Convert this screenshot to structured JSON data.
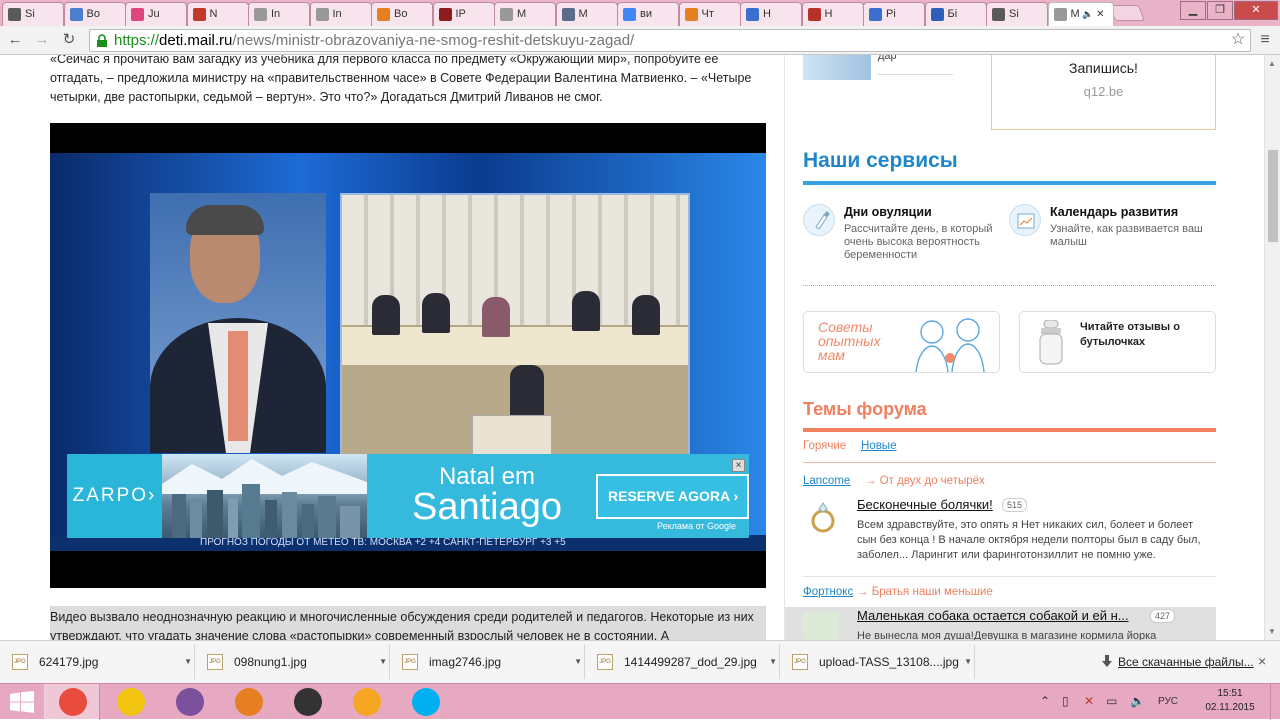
{
  "browser": {
    "tabs": [
      {
        "label": "Si",
        "icon_color": "#5a5a5a",
        "icon": "triangle-icon"
      },
      {
        "label": "Bo",
        "icon_color": "#4a7fcf",
        "icon": "grid-icon"
      },
      {
        "label": "Ju",
        "icon_color": "#e0457b",
        "icon": "letter-i-icon"
      },
      {
        "label": "N",
        "icon_color": "#c0392b",
        "icon": "nm-icon"
      },
      {
        "label": "In",
        "icon_color": "#999999",
        "icon": "page-icon"
      },
      {
        "label": "In",
        "icon_color": "#999999",
        "icon": "page-icon"
      },
      {
        "label": "Bo",
        "icon_color": "#e67e22",
        "icon": "pencil-icon"
      },
      {
        "label": "IP",
        "icon_color": "#8e1e1e",
        "icon": "circle-icon"
      },
      {
        "label": "M",
        "icon_color": "#999999",
        "icon": "page-icon"
      },
      {
        "label": "M",
        "icon_color": "#5b6b8a",
        "icon": "m-icon"
      },
      {
        "label": "ви",
        "icon_color": "#4285f4",
        "icon": "google-icon"
      },
      {
        "label": "Чт",
        "icon_color": "#e67e22",
        "icon": "pencil-icon"
      },
      {
        "label": "Н",
        "icon_color": "#3a6fd0",
        "icon": "puzzle-icon"
      },
      {
        "label": "Н",
        "icon_color": "#b8322a",
        "icon": "emblem-icon"
      },
      {
        "label": "Рі",
        "icon_color": "#3a6fd0",
        "icon": "news-icon"
      },
      {
        "label": "Бі",
        "icon_color": "#2b5fb8",
        "icon": "letter-b-icon"
      },
      {
        "label": "Si",
        "icon_color": "#5a5a5a",
        "icon": "triangle-icon"
      },
      {
        "label": "M",
        "icon_color": "#999999",
        "icon": "page-icon",
        "active": true
      }
    ],
    "url_scheme": "https://",
    "url_host": "deti.mail.ru",
    "url_path": "/news/ministr-obrazovaniya-ne-smog-reshit-detskuyu-zagad/"
  },
  "article": {
    "para1": "«Сейчас я прочитаю вам загадку из учебника для первого класса по предмету «Окружающий мир», попробуйте ее отгадать, – предложила министру на «правительственном часе» в Совете Федерации Валентина Матвиенко. – «Четыре четырки, две растопырки, седьмой – вертун». Это что?» Догадаться Дмитрий Ливанов не смог.",
    "para2": "Видео вызвало неоднозначную реакцию и многочисленные обсуждения среди родителей и педагогов. Некоторые из них утверждают, что угадать значение слова «растопырки» современный взрослый человек не в состоянии. А",
    "ticker": "ПРОГНОЗ ПОГОДЫ ОТ МЕТЕО ТВ:  МОСКВА  +2 +4  САНКТ-ПЕТЕРБУРГ  +3 +5"
  },
  "ad": {
    "brand": "ZARPO›",
    "line1": "Natal em",
    "line2": "Santiago",
    "cta": "RESERVE AGORA  ›",
    "note": "Реклама от Google",
    "close": "×"
  },
  "sidebar": {
    "top_caption": "дар\"",
    "top_cta": "Запишись!",
    "top_site": "q12.be",
    "services_title": "Наши сервисы",
    "services": [
      {
        "title": "Дни овуляции",
        "text": "Рассчитайте день, в который очень высока вероятность беременности",
        "icon": "pipette-icon"
      },
      {
        "title": "Календарь развития",
        "text": "Узнайте, как развивается ваш малыш",
        "icon": "calendar-chart-icon"
      }
    ],
    "promo_left": "Советы опытных мам",
    "promo_right": "Читайте отзывы о бутылочках",
    "forum_title": "Темы форума",
    "forum_tab_hot": "Горячие",
    "forum_tab_new": "Новые",
    "topics": [
      {
        "user": "Lancome",
        "section": "→ От двух до четырёх",
        "title": "Бесконечные болячки!",
        "count": "515",
        "text": "Всем здравствуйте, это опять я Нет никаких сил, болеет и болеет сын без конца ! В начале октября недели полторы был в саду был, заболел... Ларингит или фаринготонзиллит не помню уже."
      },
      {
        "user": "Фортнокс",
        "section": "→ Братья наши меньшие",
        "title": "Маленькая собака остается собакой и ей н...",
        "count": "427",
        "text": "Не вынесла моя душа!Девушка в магазине кормила йорка"
      }
    ]
  },
  "downloads": {
    "items": [
      "624179.jpg",
      "098nung1.jpg",
      "imag2746.jpg",
      "1414499287_dod_29.jpg",
      "upload-TASS_13108....jpg"
    ],
    "show_all": "Все скачанные файлы...",
    "file_icon_label": "JPG"
  },
  "taskbar": {
    "lang": "РУС",
    "time": "15:51",
    "date": "02.11.2015",
    "apps": [
      {
        "name": "chrome",
        "color": "#e74c3c"
      },
      {
        "name": "explorer",
        "color": "#f1c40f"
      },
      {
        "name": "viber",
        "color": "#7b519d"
      },
      {
        "name": "firefox",
        "color": "#e67e22"
      },
      {
        "name": "camera",
        "color": "#333333"
      },
      {
        "name": "chat",
        "color": "#f5a623"
      },
      {
        "name": "skype",
        "color": "#00aff0"
      }
    ]
  }
}
